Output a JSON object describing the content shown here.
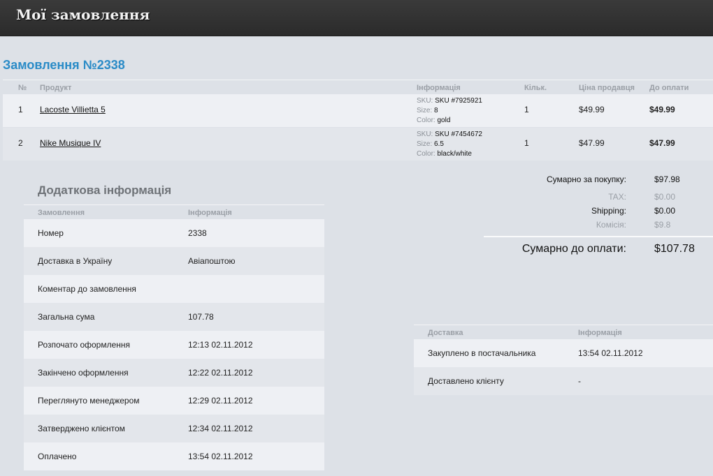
{
  "header": {
    "title": "Мої замовлення"
  },
  "order": {
    "title": "Замовлення №2338"
  },
  "products": {
    "columns": {
      "num": "№",
      "product": "Продукт",
      "info": "Інформація",
      "qty": "Кільк.",
      "price": "Ціна продавця",
      "pay": "До оплати"
    },
    "rows": [
      {
        "num": "1",
        "name": "Lacoste Villietta 5",
        "sku_label": "SKU:",
        "sku": "SKU #7925921",
        "size_label": "Size:",
        "size": "8",
        "color_label": "Color:",
        "color": "gold",
        "qty": "1",
        "price": "$49.99",
        "pay": "$49.99"
      },
      {
        "num": "2",
        "name": "Nike Musique IV",
        "sku_label": "SKU:",
        "sku": "SKU #7454672",
        "size_label": "Size:",
        "size": "6.5",
        "color_label": "Color:",
        "color": "black/white",
        "qty": "1",
        "price": "$47.99",
        "pay": "$47.99"
      }
    ]
  },
  "additional": {
    "title": "Додаткова інформація",
    "col_key": "Замовлення",
    "col_val": "Інформація",
    "rows": [
      {
        "k": "Номер",
        "v": "2338"
      },
      {
        "k": "Доставка в Україну",
        "v": "Авіапоштою"
      },
      {
        "k": "Коментар до замовлення",
        "v": ""
      },
      {
        "k": "Загальна сума",
        "v": "107.78"
      },
      {
        "k": "Розпочато оформлення",
        "v": "12:13 02.11.2012"
      },
      {
        "k": "Закінчено оформлення",
        "v": "12:22 02.11.2012"
      },
      {
        "k": "Переглянуто менеджером",
        "v": "12:29 02.11.2012"
      },
      {
        "k": "Затверджено клієнтом",
        "v": "12:34 02.11.2012"
      },
      {
        "k": "Оплачено",
        "v": "13:54 02.11.2012"
      }
    ]
  },
  "totals": {
    "subtotal_label": "Сумарно за покупку:",
    "subtotal": "$97.98",
    "tax_label": "TAX:",
    "tax": "$0.00",
    "shipping_label": "Shipping:",
    "shipping": "$0.00",
    "fee_label": "Комісія:",
    "fee": "$9.8",
    "grand_label": "Сумарно до оплати:",
    "grand": "$107.78"
  },
  "delivery": {
    "col_key": "Доставка",
    "col_val": "Інформація",
    "rows": [
      {
        "k": "Закуплено в постачальника",
        "v": "13:54 02.11.2012"
      },
      {
        "k": "Доставлено клієнту",
        "v": "-"
      }
    ]
  }
}
